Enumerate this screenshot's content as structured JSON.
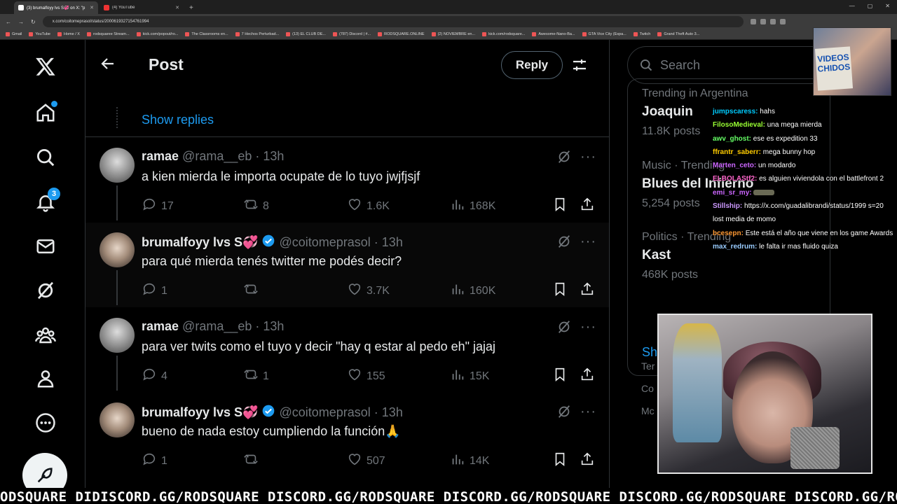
{
  "browser": {
    "tabs": [
      {
        "title": "(3) brumalfoyy lvs S💞 on X: \"p",
        "active": true
      },
      {
        "title": "(4) YouTube",
        "active": false
      }
    ],
    "url": "x.com/coitomeprasol/status/2000619327154761994",
    "bookmarks": [
      "Gmail",
      "YouTube",
      "Home / X",
      "rodsquaree Stream...",
      "kick.com/popout/ro...",
      "The Classrooms en...",
      "7 Hechos Perturbad...",
      "(13) EL CLUB DE...",
      "(787) Discord | #...",
      "RODSQUARE.ONLINE",
      "(2) NOVIEMBRE en...",
      "kick.com/rodsquare...",
      "Awesome-Nano-Ba...",
      "GTA Vice City (Espa...",
      "Twitch",
      "Grand Theft Auto 3..."
    ]
  },
  "header": {
    "title": "Post",
    "reply_label": "Reply"
  },
  "nav": {
    "notifications_count": "3"
  },
  "thread": {
    "show_replies": "Show replies",
    "tweets": [
      {
        "name": "ramae",
        "handle": "@rama__eb",
        "time": "· 13h",
        "verified": false,
        "text": "a kien mierda le importa ocupate de lo tuyo jwjfjsjf",
        "replies": "17",
        "reposts": "8",
        "likes": "1.6K",
        "views": "168K"
      },
      {
        "name": "brumalfoyy lvs S💞",
        "handle": "@coitomeprasol",
        "time": "· 13h",
        "verified": true,
        "text": "para qué mierda tenés twitter me podés decir?",
        "replies": "1",
        "reposts": "",
        "likes": "3.7K",
        "views": "160K"
      },
      {
        "name": "ramae",
        "handle": "@rama__eb",
        "time": "· 13h",
        "verified": false,
        "text": "para ver twits como el tuyo y decir \"hay q estar al pedo eh\" jajaj",
        "replies": "4",
        "reposts": "1",
        "likes": "155",
        "views": "15K"
      },
      {
        "name": "brumalfoyy lvs S💞",
        "handle": "@coitomeprasol",
        "time": "· 13h",
        "verified": true,
        "text": "bueno de nada estoy cumpliendo la función🙏",
        "replies": "1",
        "reposts": "",
        "likes": "507",
        "views": "14K"
      }
    ]
  },
  "sidebar": {
    "search_placeholder": "Search",
    "trends": [
      {
        "meta": "Trending in Argentina",
        "name": "Joaquin",
        "count": "11.8K posts"
      },
      {
        "meta": "Music · Trending",
        "name": "Blues del Infierno",
        "count": "5,254 posts"
      },
      {
        "meta": "Politics · Trending",
        "name": "Kast",
        "count": "468K posts"
      }
    ],
    "show_more": "Show more",
    "footer": [
      "Ter",
      "Co",
      "Mc"
    ]
  },
  "stream": {
    "chat": [
      {
        "user": "jumpscaress:",
        "msg": "hahs",
        "color": "#00ccff"
      },
      {
        "user": "FilosoMedieval:",
        "msg": "una mega mierda",
        "color": "#99ff33"
      },
      {
        "user": "awv_ghost:",
        "msg": "ese es expedition 33",
        "color": "#66ff66"
      },
      {
        "user": "ffrantr_saberr:",
        "msg": "mega bunny hop",
        "color": "#ffcc00"
      },
      {
        "user": "Marten_ceto:",
        "msg": "un modardo",
        "color": "#cc66ff"
      },
      {
        "user": "ELBOLAStf2:",
        "msg": "es alguien viviendola con el battlefront 2",
        "color": "#ff66cc"
      },
      {
        "user": "emi_sr_my:",
        "msg": "",
        "color": "#cc66ff"
      },
      {
        "user": "Stillship:",
        "msg": "https://x.com/guadalibrandi/status/1999 s=20 lost media de momo",
        "color": "#cc99ff"
      },
      {
        "user": "bcesepn:",
        "msg": "Este está el año que viene en los game Awards",
        "color": "#ff9933"
      },
      {
        "user": "max_redrum:",
        "msg": "le falta ir mas fluido quiza",
        "color": "#99ccff"
      }
    ],
    "webcam_sign": "VIDEOS CHIDOS",
    "ticker": "ODSQUARE DIDISCORD.GG/RODSQUARE DISCORD.GG/RODSQUARE DISCORD.GG/RODSQUARE DISCORD.GG/RODSQUARE DISCORD.GG/RODSQUARE"
  },
  "colors": {
    "accent": "#1d9bf0",
    "background": "#000000",
    "text": "#e7e9ea",
    "muted": "#71767b",
    "border": "#2f3336"
  }
}
